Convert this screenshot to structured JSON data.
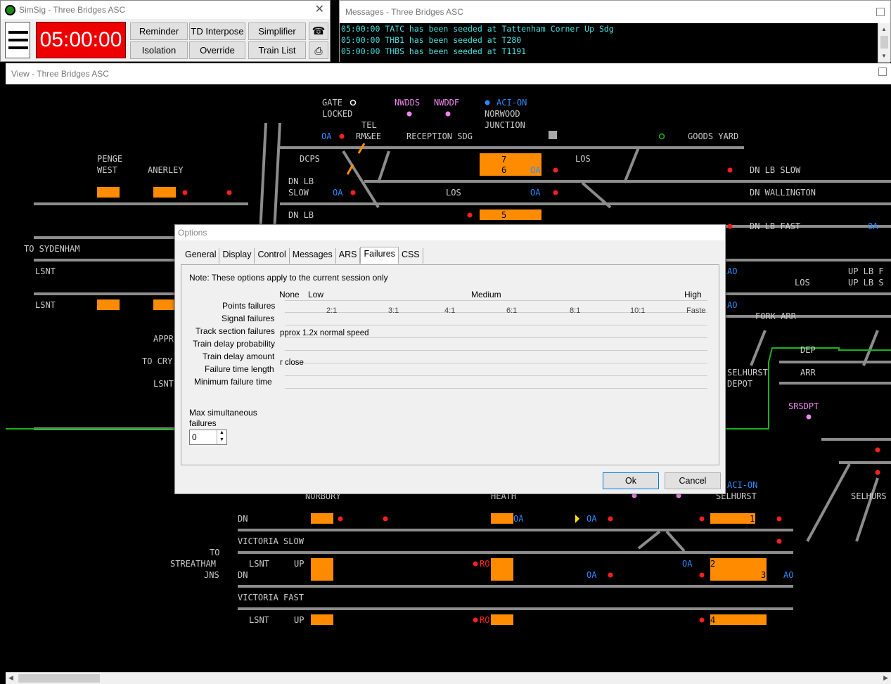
{
  "simsig": {
    "title": "SimSig - Three Bridges ASC",
    "clock": "05:00:00",
    "buttons": [
      "Reminder",
      "TD Interpose",
      "Simplifier",
      "Isolation",
      "Override",
      "Train List"
    ],
    "phone_icon": "telephone-icon",
    "print_icon": "printer-icon"
  },
  "messages": {
    "title": "Messages - Three Bridges ASC",
    "lines": [
      "05:00:00 TATC has been seeded at Tattenham Corner Up Sdg",
      "05:00:00 THB1 has been seeded at T280",
      "05:00:00 THBS has been seeded at T1191"
    ]
  },
  "view": {
    "title": "View - Three Bridges ASC",
    "labels": {
      "gate": "GATE",
      "locked": "LOCKED",
      "tel": "TEL",
      "rmee": "RM&EE",
      "nwdds": "NWDDS",
      "nwddf": "NWDDF",
      "acion": "ACI-ON",
      "norwood": "NORWOOD",
      "junction": "JUNCTION",
      "reception": "RECEPTION SDG",
      "goods": "GOODS YARD",
      "dcps": "DCPS",
      "los1": "LOS",
      "los2": "LOS",
      "penge": "PENGE",
      "west": "WEST",
      "anerley": "ANERLEY",
      "dnlbslow": "DN LB",
      "slow": "SLOW",
      "dnlb2": "DN LB",
      "dnlbslowr": "DN LB SLOW",
      "dnwall": "DN WALLINGTON",
      "dnlbfast": "DN LB FAST",
      "tosyd": "TO SYDENHAM",
      "lsnt": "LSNT",
      "appr": "APPR",
      "tocry": "TO CRY",
      "uplbf": "UP LB F",
      "uplbs": "UP LB S",
      "los3": "LOS",
      "forkarr": "FORK ARR",
      "dep": "DEP",
      "arr": "ARR",
      "selhurst": "SELHURST",
      "depot": "DEPOT",
      "srsdpt": "SRSDPT",
      "acion2": "ACI-ON",
      "selhurst2": "SELHURST",
      "selhurs": "SELHURS",
      "norbury": "NORBURY",
      "heath": "HEATH",
      "dn": "DN",
      "victoriaslow": "VICTORIA SLOW",
      "to": "TO",
      "streatham": "STREATHAM",
      "jns": "JNS",
      "up": "UP",
      "victoriafast": "VICTORIA FAST",
      "berth7": "7",
      "berth6": "6",
      "berth5": "5",
      "berth1": "1",
      "berth2": "2",
      "berth3": "3",
      "berth4": "4",
      "oa": "OA",
      "ao": "AO",
      "ro": "RO"
    }
  },
  "dialog": {
    "title": "Options",
    "tabs": [
      "General",
      "Display",
      "Control",
      "Messages",
      "ARS",
      "Failures",
      "CSS"
    ],
    "active_tab": "Failures",
    "note": "Note: These options apply to the current session only",
    "scale": {
      "none": "None",
      "low": "Low",
      "medium": "Medium",
      "high": "High"
    },
    "rows": [
      "Points failures",
      "Signal failures",
      "Track section failures",
      "Train delay probability",
      "Train delay amount",
      "Failure time length",
      "Minimum failure time"
    ],
    "ticks": [
      "2:1",
      "3:1",
      "4:1",
      "6:1",
      "8:1",
      "10:1",
      "Faste"
    ],
    "track_text": "pprox 1.2x normal speed",
    "delay_text": "r close",
    "max_label_1": "Max simultaneous",
    "max_label_2": "failures",
    "max_value": "0",
    "ok": "Ok",
    "cancel": "Cancel"
  }
}
